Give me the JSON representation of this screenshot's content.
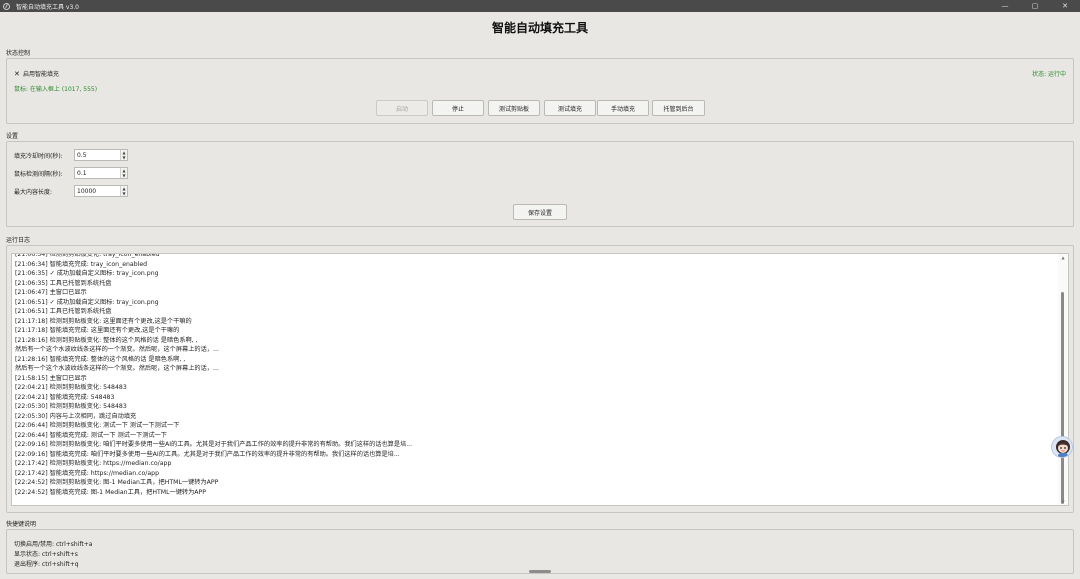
{
  "window": {
    "title": "智能自动填充工具 v3.0",
    "minimize_glyph": "—",
    "maximize_glyph": "▢",
    "close_glyph": "✕"
  },
  "app_title": "智能自动填充工具",
  "status_section": {
    "label": "状态控制",
    "checkbox_mark": "✕",
    "checkbox_label": "启用智能填充",
    "checked": true,
    "mouse_status": "鼠标: 在输入框上 (1017, 555)",
    "run_status": "状态: 运行中",
    "buttons": {
      "start": "启动",
      "stop": "停止",
      "test_clipboard": "测试剪贴板",
      "test_fill": "测试填充",
      "manual_fill": "手动填充",
      "hide_to_tray": "托管到后台"
    }
  },
  "settings_section": {
    "label": "设置",
    "fill_cooldown_label": "填充冷却时间(秒):",
    "fill_cooldown_value": "0.5",
    "mouse_interval_label": "鼠标检测间隔(秒):",
    "mouse_interval_value": "0.1",
    "max_length_label": "最大内容长度:",
    "max_length_value": "10000",
    "save_button": "保存设置",
    "spin_up": "▲",
    "spin_down": "▼"
  },
  "log_section": {
    "label": "运行日志",
    "scroll_up": "▲",
    "scroll_down": "▼",
    "lines": [
      "[21:06:34] 检测到剪贴板变化: tray_icon_enabled",
      "[21:06:34] 智能填充完成: tray_icon_enabled",
      "[21:06:35] ✓ 成功加载自定义图标: tray_icon.png",
      "[21:06:35] 工具已托管到系统托盘",
      "[21:06:47] 主窗口已显示",
      "[21:06:51] ✓ 成功加载自定义图标: tray_icon.png",
      "[21:06:51] 工具已托管到系统托盘",
      "[21:17:18] 检测到剪贴板变化: 这里面还有个更改,这是个干嘛的",
      "[21:17:18] 智能填充完成: 这里面还有个更改,这是个干嘛的",
      "[21:28:16] 检测到剪贴板变化: 整体的这个风格的话 是暗色系啊, ,",
      "然后有一个这个水波纹线条这样的一个渐变。然后呢，这个屏幕上的话，...",
      "[21:28:16] 智能填充完成: 整体的这个风格的话 是暗色系啊, ,",
      "然后有一个这个水波纹线条这样的一个渐变。然后呢，这个屏幕上的话，...",
      "[21:58:15] 主窗口已显示",
      "[22:04:21] 检测到剪贴板变化: 548483",
      "[22:04:21] 智能填充完成: 548483",
      "[22:05:30] 检测到剪贴板变化: 548483",
      "[22:05:30] 内容与上次相同，跳过自动填充",
      "[22:06:44] 检测到剪贴板变化: 测试一下 测试一下测试一下",
      "[22:06:44] 智能填充完成: 测试一下 测试一下测试一下",
      "[22:09:16] 检测到剪贴板变化: 咱们平时要多使用一些AI的工具。尤其是对于我们产品工作的效率的提升非常的有帮助。我们这样的话也算是培...",
      "[22:09:16] 智能填充完成: 咱们平时要多使用一些AI的工具。尤其是对于我们产品工作的效率的提升非常的有帮助。我们这样的话也算是培...",
      "[22:17:42] 检测到剪贴板变化: https://median.co/app",
      "[22:17:42] 智能填充完成: https://median.co/app",
      "[22:24:52] 检测到剪贴板变化: 图-1      Median工具，把HTML一键转为APP",
      "[22:24:52] 智能填充完成: 图-1      Median工具，把HTML一键转为APP"
    ]
  },
  "shortcuts_section": {
    "label": "快捷键说明",
    "lines": [
      "切换启用/禁用: ctrl+shift+a",
      "显示状态: ctrl+shift+s",
      "退出程序: ctrl+shift+q"
    ]
  },
  "colors": {
    "titlebar": "#4a4a4a",
    "background": "#e8e7e3",
    "status_green": "#2e8b2e"
  },
  "icons": [
    "app-feather-icon",
    "avatar-assistant-icon"
  ]
}
